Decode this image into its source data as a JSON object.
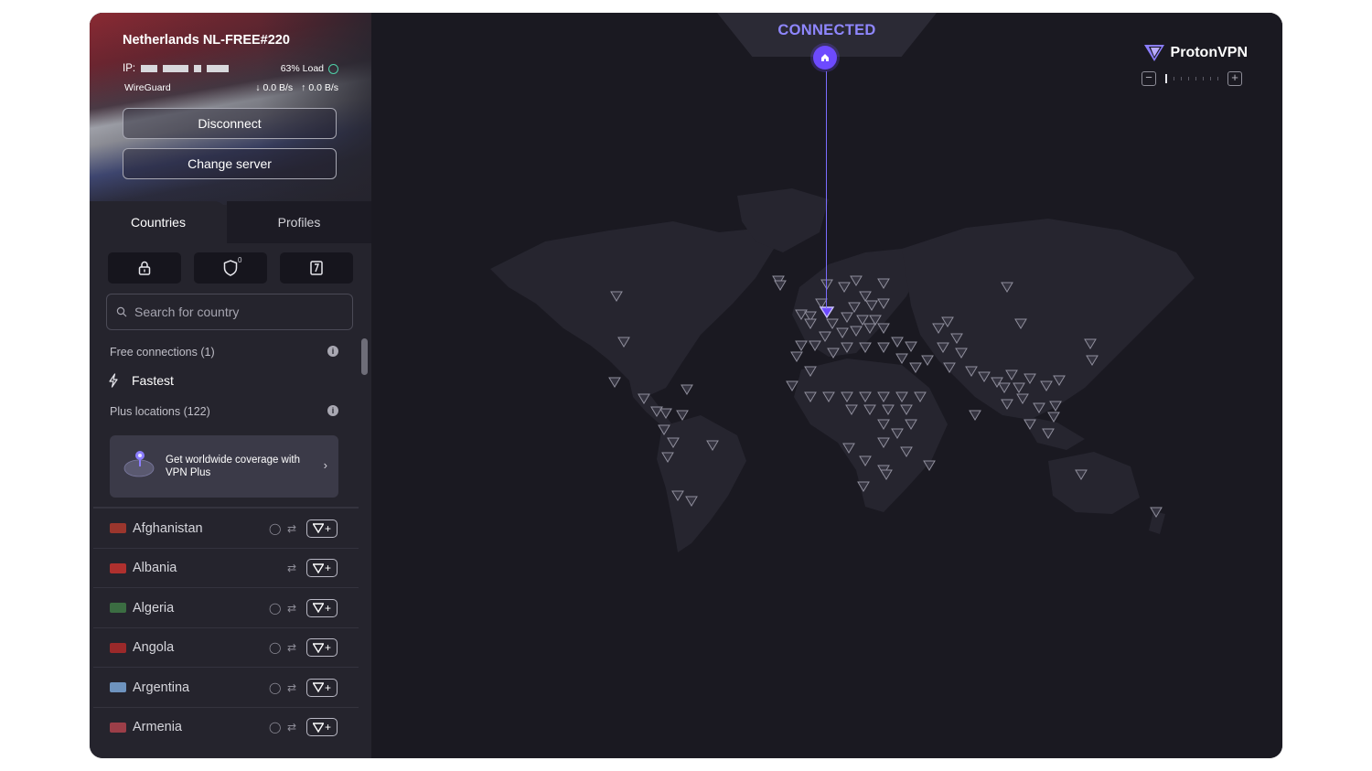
{
  "connection": {
    "server": "Netherlands NL-FREE#220",
    "ip_label": "IP:",
    "load": "63% Load",
    "protocol": "WireGuard",
    "download": "0.0 B/s",
    "upload": "0.0 B/s",
    "disconnect_label": "Disconnect",
    "change_server_label": "Change server",
    "status": "CONNECTED"
  },
  "tabs": {
    "countries": "Countries",
    "profiles": "Profiles"
  },
  "filters": [
    {
      "icon": "lock-icon"
    },
    {
      "icon": "shield-icon",
      "count": "0"
    },
    {
      "icon": "netshield-icon"
    }
  ],
  "search": {
    "placeholder": "Search for country"
  },
  "sections": {
    "free": "Free connections (1)",
    "fastest": "Fastest",
    "plus": "Plus locations (122)"
  },
  "promo": {
    "text": "Get worldwide coverage with VPN Plus"
  },
  "countries": [
    {
      "name": "Afghanistan",
      "globe": true,
      "p2p": true,
      "flag": "#b03a2e"
    },
    {
      "name": "Albania",
      "globe": false,
      "p2p": true,
      "flag": "#c8322f"
    },
    {
      "name": "Algeria",
      "globe": true,
      "p2p": true,
      "flag": "#3f7a47"
    },
    {
      "name": "Angola",
      "globe": true,
      "p2p": true,
      "flag": "#b02a2a"
    },
    {
      "name": "Argentina",
      "globe": true,
      "p2p": true,
      "flag": "#7ba7d8"
    },
    {
      "name": "Armenia",
      "globe": true,
      "p2p": true,
      "flag": "#b2434d"
    }
  ],
  "brand": {
    "name": "ProtonVPN",
    "accent": "#6d4aff"
  }
}
